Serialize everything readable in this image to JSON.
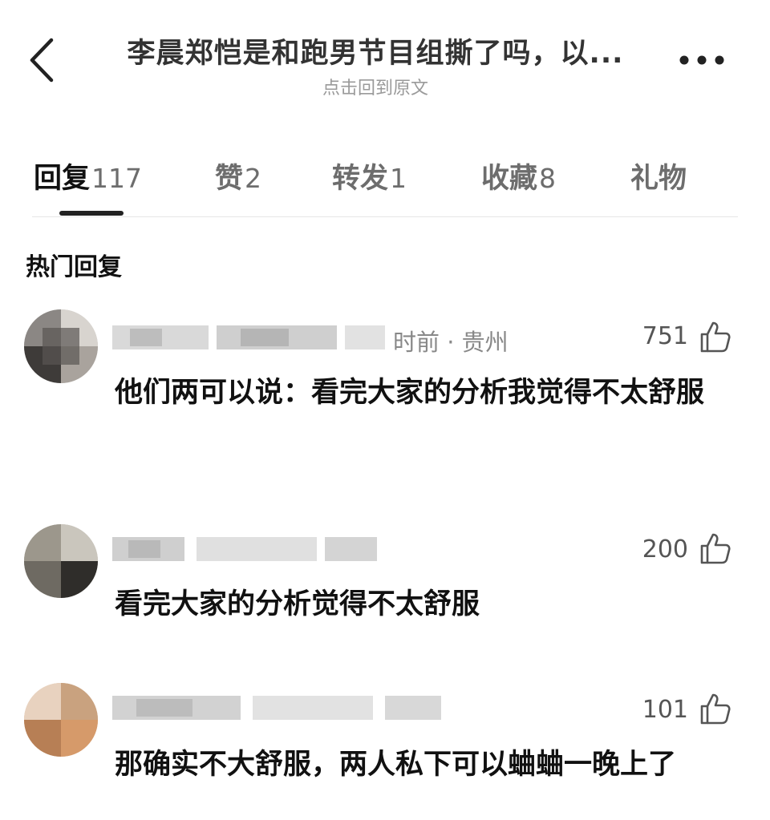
{
  "header": {
    "title": "李晨郑恺是和跑男节目组撕了吗，以...",
    "subtitle": "点击回到原文"
  },
  "tabs": [
    {
      "label": "回复",
      "count": "117"
    },
    {
      "label": "赞",
      "count": "2"
    },
    {
      "label": "转发",
      "count": "1"
    },
    {
      "label": "收藏",
      "count": "8"
    },
    {
      "label": "礼物",
      "count": ""
    }
  ],
  "section_title": "热门回复",
  "comments": [
    {
      "meta": "时前 · 贵州",
      "likes": "751",
      "text": "他们两可以说：看完大家的分析我觉得不太舒服"
    },
    {
      "meta": "",
      "likes": "200",
      "text": "看完大家的分析觉得不太舒服"
    },
    {
      "meta": "",
      "likes": "101",
      "text": "那确实不大舒服，两人私下可以蛐蛐一晚上了"
    }
  ],
  "icons": {
    "back": "chevron-left-icon",
    "more": "more-dots-icon",
    "like": "thumbs-up-icon"
  },
  "colors": {
    "text_primary": "#111111",
    "text_secondary": "#9a9a9a",
    "tab_indicator": "#222222"
  }
}
